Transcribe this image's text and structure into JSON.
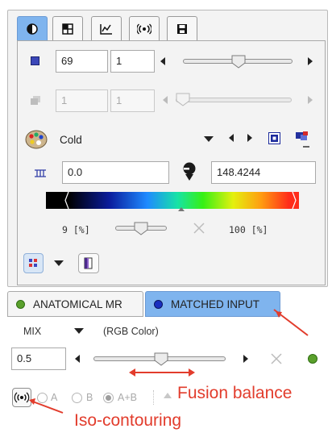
{
  "top_tabs": [
    {
      "icon": "contrast-icon",
      "active": true
    },
    {
      "icon": "grid-icon",
      "active": false
    },
    {
      "icon": "chart-icon",
      "active": false
    },
    {
      "icon": "broadcast-icon",
      "active": false
    },
    {
      "icon": "save-icon",
      "active": false
    }
  ],
  "row1": {
    "value1": "69",
    "value2": "1",
    "slider_position": 0.5
  },
  "row2": {
    "value1": "1",
    "value2": "1",
    "slider_position": 0.0
  },
  "colormap": {
    "name": "Cold"
  },
  "range": {
    "min": "0.0",
    "max": "148.4244"
  },
  "percent_row": {
    "left": "9 [%]",
    "right": "100 [%]"
  },
  "bottom_tabs": {
    "anatomical": "ANATOMICAL MR",
    "matched": "MATCHED INPUT"
  },
  "mix": {
    "label": "MIX",
    "mode": "(RGB Color)"
  },
  "fusion": {
    "value": "0.5",
    "slider_position": 0.5
  },
  "radio": {
    "a": "A",
    "b": "B",
    "ab": "A+B",
    "selected": "A+B"
  },
  "annotations": {
    "fusion": "Fusion balance",
    "iso": "Iso-contouring"
  },
  "colors": {
    "accent": "#7fb4ee",
    "annotation": "#e23c2c",
    "green_dot": "#5aa02c",
    "blue_dot": "#1a2fc0"
  }
}
